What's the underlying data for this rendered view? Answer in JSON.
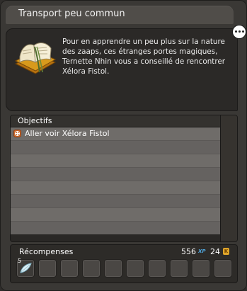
{
  "window": {
    "title": "Transport peu commun"
  },
  "quest": {
    "description": "Pour en apprendre un peu plus sur la nature des zaaps, ces étranges portes magiques, Ternette Nhin vous a conseillé de rencontrer Xélora Fistol.",
    "image_icon": "open-book-icon"
  },
  "objectives": {
    "header": "Objectifs",
    "rows": [
      {
        "text": "Aller voir Xélora Fistol",
        "icon": "objective-orange-icon"
      },
      {
        "text": ""
      },
      {
        "text": ""
      },
      {
        "text": ""
      },
      {
        "text": ""
      },
      {
        "text": ""
      },
      {
        "text": ""
      },
      {
        "text": ""
      }
    ]
  },
  "rewards": {
    "label": "Récompenses",
    "xp": "556",
    "xp_unit": "XP",
    "kamas": "24",
    "kama_unit": "K",
    "slots": [
      {
        "qty": "5",
        "icon": "feather-icon"
      },
      {
        "qty": ""
      },
      {
        "qty": ""
      },
      {
        "qty": ""
      },
      {
        "qty": ""
      },
      {
        "qty": ""
      },
      {
        "qty": ""
      },
      {
        "qty": ""
      },
      {
        "qty": ""
      },
      {
        "qty": ""
      }
    ]
  },
  "colors": {
    "window_bg": "#3a3835",
    "row_light": "#6f6c69",
    "row_dark": "#656260",
    "accent_orange": "#cc6a2c",
    "xp_blue": "#4fa3d8",
    "kama_gold": "#e0a62a"
  }
}
